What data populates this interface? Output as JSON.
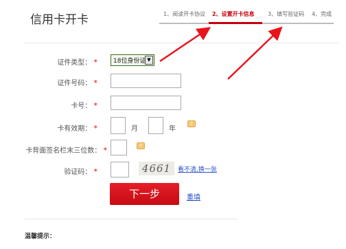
{
  "header": {
    "title": "信用卡开卡",
    "steps": [
      {
        "label": "1、阅读开卡协议",
        "active": false
      },
      {
        "label": "2、设置开卡信息",
        "active": true
      },
      {
        "label": "3、填写验证码",
        "active": false
      },
      {
        "label": "4、完成",
        "active": false
      }
    ]
  },
  "form": {
    "id_type": {
      "label": "证件类型：",
      "value": "18位身份证"
    },
    "id_number": {
      "label": "证件号码：",
      "value": ""
    },
    "card_number": {
      "label": "卡号：",
      "value": ""
    },
    "expiry": {
      "label": "卡有效期：",
      "month_unit": "月",
      "year_unit": "年"
    },
    "cvv": {
      "label": "卡背面签名栏末三位数：",
      "value": ""
    },
    "captcha": {
      "label": "验证码：",
      "image_text": "4661",
      "refresh_link": "看不清,换一张"
    },
    "required_mark": "*"
  },
  "actions": {
    "next": "下一步",
    "reset": "重填"
  },
  "footer": {
    "tip_title": "温馨提示："
  },
  "colors": {
    "accent": "#c8000b",
    "link": "#2a52c8",
    "button": "#d41119"
  }
}
